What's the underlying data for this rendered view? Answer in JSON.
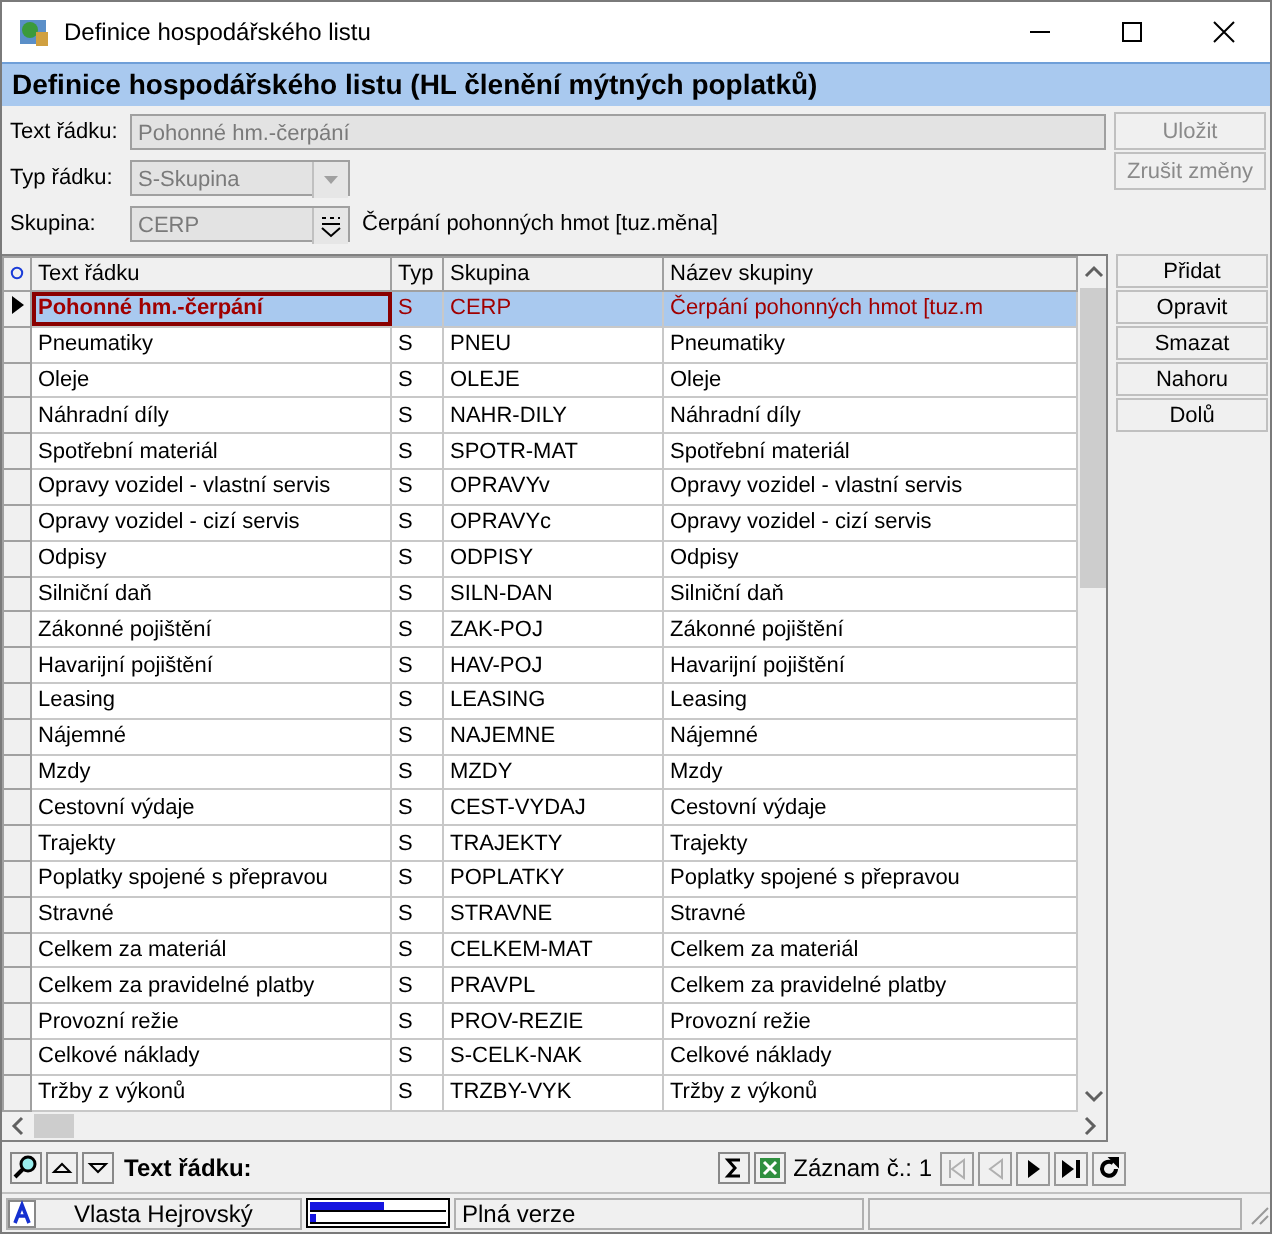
{
  "window": {
    "title": "Definice hospodářského listu"
  },
  "header": "Definice hospodářského listu (HL členění mýtných poplatků)",
  "form": {
    "text_label": "Text řádku:",
    "text_value": "Pohonné hm.-čerpání",
    "type_label": "Typ řádku:",
    "type_value": "S-Skupina",
    "group_label": "Skupina:",
    "group_value": "CERP",
    "group_name": "Čerpání pohonných hmot [tuz.měna]",
    "disabled": true
  },
  "form_buttons": [
    {
      "label": "Uložit",
      "disabled": true
    },
    {
      "label": "Zrušit změny",
      "disabled": true
    }
  ],
  "side_buttons": [
    "Přidat",
    "Opravit",
    "Smazat",
    "Nahoru",
    "Dolů"
  ],
  "table": {
    "columns": [
      "Text řádku",
      "Typ",
      "Skupina",
      "Název skupiny"
    ],
    "rows": [
      {
        "cells": [
          "Pohonné hm.-čerpání",
          "S",
          "CERP",
          "Čerpání pohonných hmot [tuz.m"
        ],
        "selected": true
      },
      {
        "cells": [
          "Pneumatiky",
          "S",
          "PNEU",
          "Pneumatiky"
        ],
        "selected": false
      },
      {
        "cells": [
          "Oleje",
          "S",
          "OLEJE",
          "Oleje"
        ],
        "selected": false
      },
      {
        "cells": [
          "Náhradní díly",
          "S",
          "NAHR-DILY",
          "Náhradní díly"
        ],
        "selected": false
      },
      {
        "cells": [
          "Spotřební materiál",
          "S",
          "SPOTR-MAT",
          "Spotřební materiál"
        ],
        "selected": false
      },
      {
        "cells": [
          "Opravy vozidel - vlastní servis",
          "S",
          "OPRAVYv",
          "Opravy vozidel - vlastní servis"
        ],
        "selected": false
      },
      {
        "cells": [
          "Opravy vozidel - cizí servis",
          "S",
          "OPRAVYc",
          "Opravy vozidel - cizí servis"
        ],
        "selected": false
      },
      {
        "cells": [
          "Odpisy",
          "S",
          "ODPISY",
          "Odpisy"
        ],
        "selected": false
      },
      {
        "cells": [
          "Silniční daň",
          "S",
          "SILN-DAN",
          "Silniční daň"
        ],
        "selected": false
      },
      {
        "cells": [
          "Zákonné pojištění",
          "S",
          "ZAK-POJ",
          "Zákonné pojištění"
        ],
        "selected": false
      },
      {
        "cells": [
          "Havarijní pojištění",
          "S",
          "HAV-POJ",
          "Havarijní pojištění"
        ],
        "selected": false
      },
      {
        "cells": [
          "Leasing",
          "S",
          "LEASING",
          "Leasing"
        ],
        "selected": false
      },
      {
        "cells": [
          "Nájemné",
          "S",
          "NAJEMNE",
          "Nájemné"
        ],
        "selected": false
      },
      {
        "cells": [
          "Mzdy",
          "S",
          "MZDY",
          "Mzdy"
        ],
        "selected": false
      },
      {
        "cells": [
          "Cestovní výdaje",
          "S",
          "CEST-VYDAJ",
          "Cestovní výdaje"
        ],
        "selected": false
      },
      {
        "cells": [
          "Trajekty",
          "S",
          "TRAJEKTY",
          "Trajekty"
        ],
        "selected": false
      },
      {
        "cells": [
          "Poplatky spojené s přepravou",
          "S",
          "POPLATKY",
          "Poplatky spojené s přepravou"
        ],
        "selected": false
      },
      {
        "cells": [
          "Stravné",
          "S",
          "STRAVNE",
          "Stravné"
        ],
        "selected": false
      },
      {
        "cells": [
          "Celkem za materiál",
          "S",
          "CELKEM-MAT",
          "Celkem za materiál"
        ],
        "selected": false
      },
      {
        "cells": [
          "Celkem za pravidelné platby",
          "S",
          "PRAVPL",
          "Celkem za pravidelné platby"
        ],
        "selected": false
      },
      {
        "cells": [
          "Provozní režie",
          "S",
          "PROV-REZIE",
          "Provozní režie"
        ],
        "selected": false
      },
      {
        "cells": [
          "Celkové náklady",
          "S",
          "S-CELK-NAK",
          "Celkové náklady"
        ],
        "selected": false
      },
      {
        "cells": [
          "Tržby z výkonů",
          "S",
          "TRZBY-VYK",
          "Tržby z výkonů"
        ],
        "selected": false
      }
    ]
  },
  "toolbar": {
    "field_label": "Text řádku:",
    "record_label": "Záznam č.: 1",
    "nav": [
      {
        "kind": "first",
        "disabled": true
      },
      {
        "kind": "prev",
        "disabled": true
      },
      {
        "kind": "next",
        "disabled": false
      },
      {
        "kind": "last",
        "disabled": false
      },
      {
        "kind": "refresh",
        "disabled": false
      }
    ]
  },
  "status_bar": {
    "user": "Vlasta Hejrovský",
    "meter": [
      {
        "level": 0.55
      },
      {
        "level": 0.04
      }
    ],
    "version": "Plná verze"
  }
}
